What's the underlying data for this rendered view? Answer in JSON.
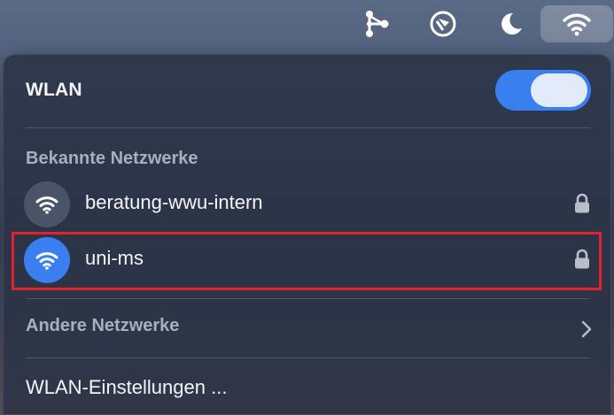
{
  "menubar": {
    "icons": [
      "share-network-icon",
      "safari-compass-icon",
      "moon-icon",
      "wifi-icon"
    ]
  },
  "wifi_panel": {
    "title": "WLAN",
    "toggle_on": true,
    "known_networks_label": "Bekannte Netzwerke",
    "known_networks": [
      {
        "name": "beratung-wwu-intern",
        "connected": false,
        "secured": true
      },
      {
        "name": "uni-ms",
        "connected": true,
        "secured": true
      }
    ],
    "other_networks_label": "Andere Netzwerke",
    "settings_label": "WLAN-Einstellungen ..."
  },
  "colors": {
    "accent": "#3a7ff0",
    "highlight": "#e0232e"
  }
}
